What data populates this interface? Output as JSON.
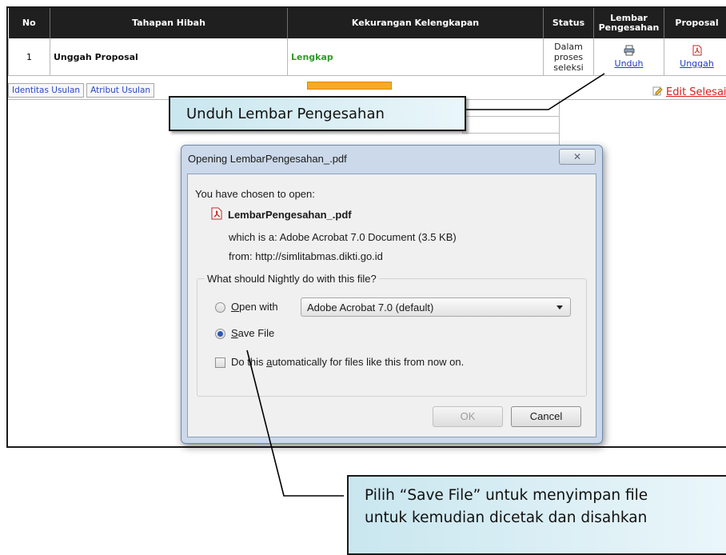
{
  "table": {
    "headers": {
      "no": "No",
      "stage": "Tahapan Hibah",
      "lack": "Kekurangan Kelengkapan",
      "status": "Status",
      "sheet": [
        "Lembar",
        "Pengesahan"
      ],
      "proposal": "Proposal"
    },
    "row": {
      "no": "1",
      "stage": "Unggah Proposal",
      "lack": "Lengkap",
      "status": [
        "Dalam",
        "proses",
        "seleksi"
      ],
      "sheet_link": "Unduh",
      "proposal_link": "Unggah"
    }
  },
  "tabs": [
    "Identitas Usulan",
    "Atribut Usulan"
  ],
  "edit_link": "Edit Selesai",
  "callouts": {
    "top": "Unduh Lembar Pengesahan",
    "bottom": [
      "Pilih “Save File” untuk menyimpan file",
      "untuk kemudian dicetak dan disahkan"
    ]
  },
  "dialog": {
    "title": "Opening LembarPengesahan_.pdf",
    "intro": "You have chosen to open:",
    "filename": "LembarPengesahan_.pdf",
    "which_is": "which is a:  Adobe Acrobat 7.0 Document (3.5 KB)",
    "from": "from:  http://simlitabmas.dikti.go.id",
    "question": "What should Nightly do with this file?",
    "open_with": {
      "pre": "",
      "key": "O",
      "post": "pen with"
    },
    "open_with_app": "Adobe Acrobat 7.0 (default)",
    "save_file": {
      "key": "S",
      "post": "ave File"
    },
    "auto": {
      "pre": "Do this ",
      "key": "a",
      "post": "utomatically for files like this from now on."
    },
    "ok": "OK",
    "cancel": "Cancel",
    "selected_option": "save_file",
    "auto_checked": false
  },
  "colors": {
    "header_bg": "#1f1f1f",
    "lengkap_green": "#2f9a2a",
    "link_blue": "#1a3ccb",
    "edit_red": "#dc1b1b",
    "callout_bg": "#c9e6ef"
  },
  "icons": {
    "sheet": "printer-icon",
    "proposal": "pdf-icon",
    "edit": "pencil-icon",
    "file": "pdf-file-icon",
    "close": "close-icon"
  }
}
